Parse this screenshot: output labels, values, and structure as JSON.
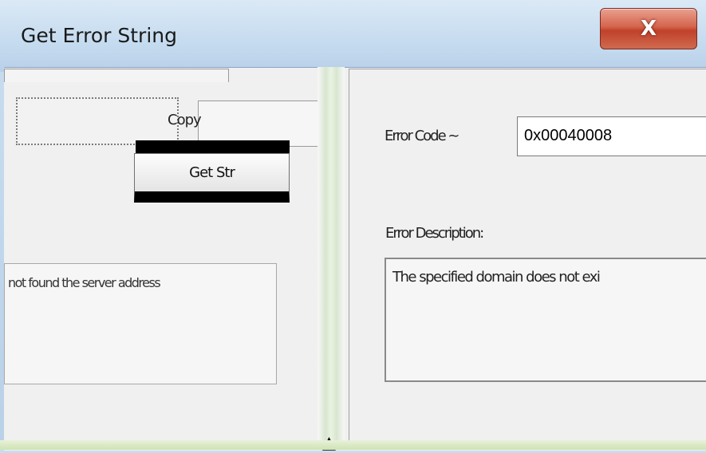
{
  "window": {
    "title": "Get Error String",
    "close_icon": "close-icon",
    "close_glyph": "X"
  },
  "left_pane": {
    "copy_button_label": "Copy",
    "get_button_label": "Get Str",
    "message_text": "not found the server address"
  },
  "right_pane": {
    "error_code_label": "Error Code ~",
    "error_code_value": "0x00040008",
    "error_description_label": "Error Description:",
    "error_description_text": "The specified domain does not exi"
  },
  "colors": {
    "close_button": "#c8452e",
    "titlebar": "#c5dbef",
    "client_bg": "#f0f0f0"
  }
}
